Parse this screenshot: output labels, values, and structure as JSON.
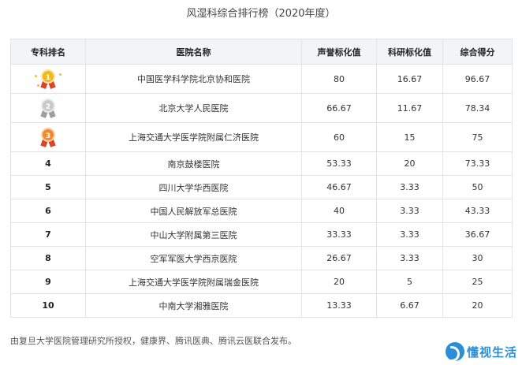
{
  "title": "风湿科综合排行榜（2020年度）",
  "headers": [
    "专科排名",
    "医院名称",
    "声誉标化值",
    "科研标化值",
    "综合得分"
  ],
  "rows": [
    {
      "rank": "1",
      "medal": "gold",
      "hospital": "中国医学科学院北京协和医院",
      "reputation": "80",
      "research": "16.67",
      "total": "96.67"
    },
    {
      "rank": "2",
      "medal": "silver",
      "hospital": "北京大学人民医院",
      "reputation": "66.67",
      "research": "11.67",
      "total": "78.34"
    },
    {
      "rank": "3",
      "medal": "bronze",
      "hospital": "上海交通大学医学院附属仁济医院",
      "reputation": "60",
      "research": "15",
      "total": "75"
    },
    {
      "rank": "4",
      "medal": "",
      "hospital": "南京鼓楼医院",
      "reputation": "53.33",
      "research": "20",
      "total": "73.33"
    },
    {
      "rank": "5",
      "medal": "",
      "hospital": "四川大学华西医院",
      "reputation": "46.67",
      "research": "3.33",
      "total": "50"
    },
    {
      "rank": "6",
      "medal": "",
      "hospital": "中国人民解放军总医院",
      "reputation": "40",
      "research": "3.33",
      "total": "43.33"
    },
    {
      "rank": "7",
      "medal": "",
      "hospital": "中山大学附属第三医院",
      "reputation": "33.33",
      "research": "3.33",
      "total": "36.67"
    },
    {
      "rank": "8",
      "medal": "",
      "hospital": "空军军医大学西京医院",
      "reputation": "26.67",
      "research": "3.33",
      "total": "30"
    },
    {
      "rank": "9",
      "medal": "",
      "hospital": "上海交通大学医学院附属瑞金医院",
      "reputation": "20",
      "research": "5",
      "total": "25"
    },
    {
      "rank": "10",
      "medal": "",
      "hospital": "中南大学湘雅医院",
      "reputation": "13.33",
      "research": "6.67",
      "total": "20"
    }
  ],
  "footer": "由复旦大学医院管理研究所授权，健康界、腾讯医典、腾讯云医联合发布。",
  "logo_text": "懂视生活"
}
